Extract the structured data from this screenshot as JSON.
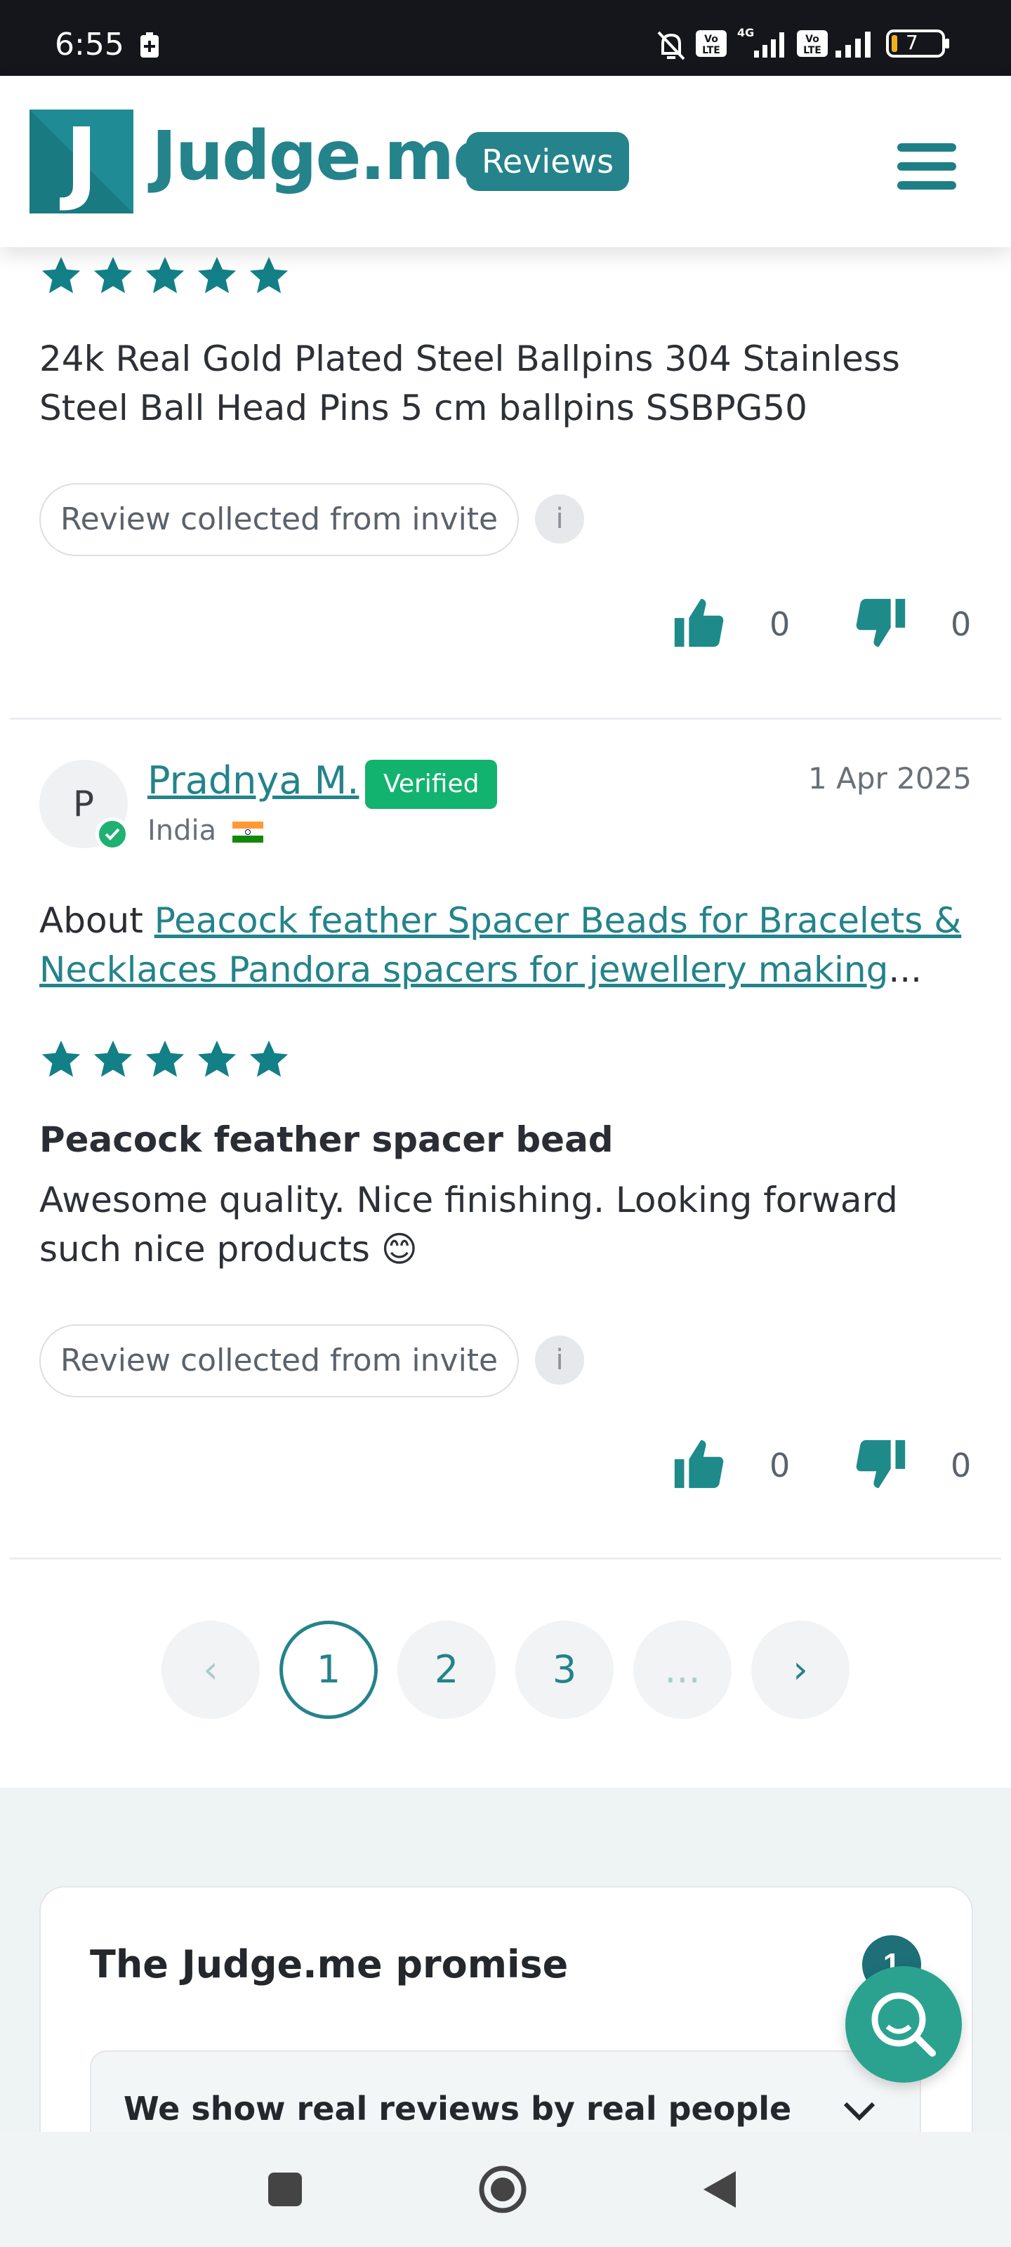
{
  "status_bar": {
    "time": "6:55",
    "battery_level": "7",
    "icons": [
      "battery-saver-icon",
      "bell-muted-icon",
      "volte-icon",
      "signal-4g-icon",
      "volte-icon",
      "signal-icon",
      "battery-icon"
    ]
  },
  "header": {
    "logo_letter": "J",
    "brand": "Judge.me",
    "badge": "Reviews",
    "menu_icon": "hamburger-menu-icon"
  },
  "colors": {
    "teal": "#24838b",
    "star": "#137f86",
    "verified_green": "#12b36e",
    "fab": "#2aa28f"
  },
  "review_1": {
    "rating": 5,
    "body": "24k Real Gold Plated Steel Ballpins 304 Stainless Steel Ball Head Pins 5 cm ballpins SSBPG50",
    "source_label": "Review collected from invite",
    "info_label": "i",
    "helpful_count": "0",
    "unhelpful_count": "0"
  },
  "review_2": {
    "avatar_initial": "P",
    "name": "Pradnya M.",
    "verified_label": "Verified",
    "country": "India",
    "date": "1 Apr 2025",
    "about_prefix": "About ",
    "product_link": "Peacock feather Spacer Beads for Bracelets & Necklaces Pandora spacers for jewellery making",
    "ellipsis": "...",
    "rating": 5,
    "title": "Peacock feather spacer bead",
    "body": "Awesome quality. Nice finishing. Looking forward such nice products 😊",
    "source_label": "Review collected from invite",
    "info_label": "i",
    "helpful_count": "0",
    "unhelpful_count": "0"
  },
  "pagination": {
    "prev": "‹",
    "pages": [
      "1",
      "2",
      "3"
    ],
    "ellipsis": "...",
    "next": "›",
    "current": "1"
  },
  "promise": {
    "title": "The Judge.me promise",
    "badge": "1",
    "item": "We show real reviews by real people"
  },
  "nav_bar": {
    "icons": [
      "recents-square-icon",
      "home-circle-icon",
      "back-triangle-icon"
    ]
  }
}
